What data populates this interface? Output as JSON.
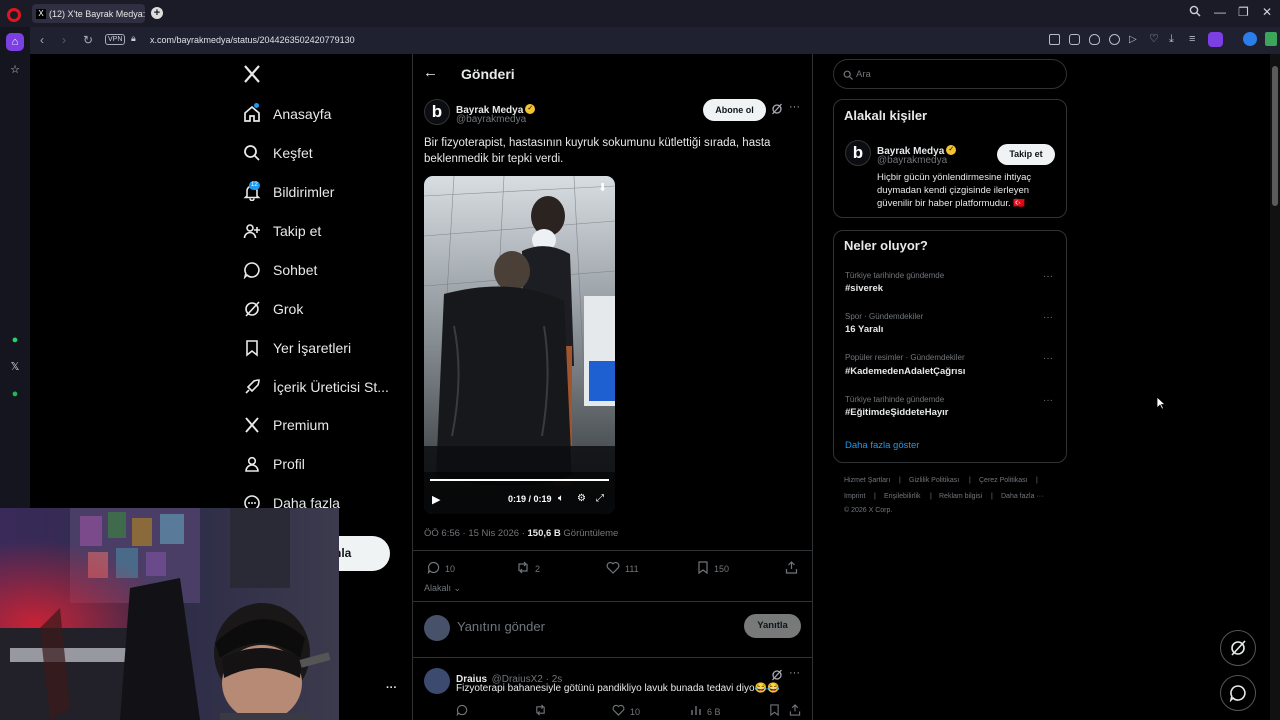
{
  "browser": {
    "tab_title": "(12) X'te Bayrak Medya: \"",
    "url": "x.com/bayrakmedya/status/2044263502420779130",
    "vpn_label": "VPN"
  },
  "nav": {
    "items": [
      {
        "label": "Anasayfa",
        "icon": "home-icon"
      },
      {
        "label": "Keşfet",
        "icon": "search-icon"
      },
      {
        "label": "Bildirimler",
        "icon": "bell-icon"
      },
      {
        "label": "Takip et",
        "icon": "person-add-icon"
      },
      {
        "label": "Sohbet",
        "icon": "chat-icon"
      },
      {
        "label": "Grok",
        "icon": "grok-icon"
      },
      {
        "label": "Yer İşaretleri",
        "icon": "bookmark-icon"
      },
      {
        "label": "İçerik Üreticisi St...",
        "icon": "rocket-icon"
      },
      {
        "label": "Premium",
        "icon": "x-logo-icon"
      },
      {
        "label": "Profil",
        "icon": "profile-icon"
      },
      {
        "label": "Daha fazla",
        "icon": "more-circle-icon"
      }
    ],
    "notif_count": "12",
    "post_button_partial": "nla",
    "account_more": "···"
  },
  "post": {
    "header_title": "Gönderi",
    "author_name": "Bayrak Medya",
    "author_handle": "@bayrakmedya",
    "avatar_letter": "b",
    "follow_label": "Abone ol",
    "text": "Bir fizyoterapist, hastasının kuyruk sokumunu kütlettiği sırada, hasta beklenmedik bir tepki verdi.",
    "video_time": "0:19 / 0:19",
    "video_progress": 1.0,
    "time": "ÖÖ 6:56 · 15 Nis 2026 · ",
    "views_count": "150,6 B",
    "views_label": " Görüntüleme",
    "stats": {
      "replies": "10",
      "reposts": "2",
      "likes": "111",
      "bookmarks": "150"
    },
    "related_label": "Alakalı",
    "reply_placeholder": "Yanıtını gönder",
    "reply_button": "Yanıtla"
  },
  "comment": {
    "name": "Draius",
    "handle": "@DraiusX2 · 2s",
    "text": "Fizyoterapi bahanesiyle götünü pandikliyo lavuk bunada tedavi diyo😂😂",
    "stats": {
      "replies": "",
      "likes": "10",
      "views": "6 B"
    }
  },
  "search": {
    "placeholder": "Ara"
  },
  "related_people": {
    "title": "Alakalı kişiler",
    "name": "Bayrak Medya",
    "handle": "@bayrakmedya",
    "follow_label": "Takip et",
    "bio": "Hiçbir gücün yönlendirmesine ihtiyaç duymadan kendi çizgisinde ilerleyen güvenilir bir haber platformudur. 🇹🇷"
  },
  "trends": {
    "title": "Neler oluyor?",
    "items": [
      {
        "category": "Türkiye tarihinde gündemde",
        "name": "#siverek"
      },
      {
        "category": "Spor · Gündemdekiler",
        "name": "16 Yaralı"
      },
      {
        "category": "Popüler resimler · Gündemdekiler",
        "name": "#KademedenAdaletÇağrısı"
      },
      {
        "category": "Türkiye tarihinde gündemde",
        "name": "#EğitimdeŞiddeteHayır"
      }
    ],
    "show_more": "Daha fazla göster"
  },
  "footer": {
    "links": [
      "Hizmet Şartları",
      "|",
      "Gizlilik Politikası",
      "|",
      "Çerez Politikası",
      "|",
      "Imprint",
      "|",
      "Erişilebilirlik",
      "|",
      "Reklam bilgisi",
      "|",
      "Daha fazla ···"
    ],
    "copyright": "© 2026 X Corp."
  },
  "colors": {
    "accent": "#1d9bf0",
    "background": "#000000",
    "text": "#e7e9ea",
    "muted": "#71767b",
    "border": "#2f3336"
  }
}
